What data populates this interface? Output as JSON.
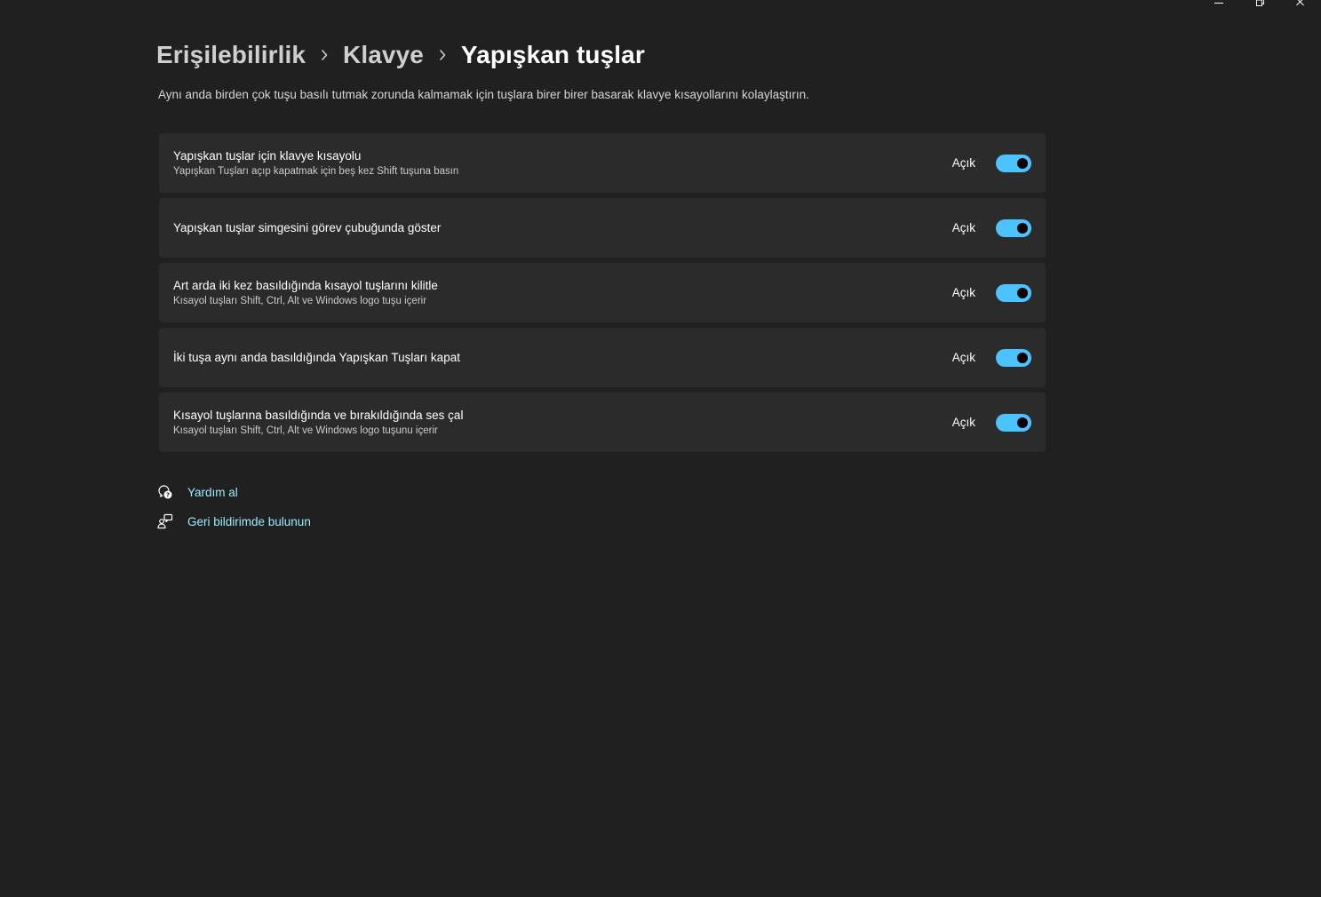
{
  "window": {
    "minimize_icon": "minimize-icon",
    "maximize_icon": "restore-icon",
    "close_icon": "close-icon"
  },
  "breadcrumb": {
    "items": [
      "Erişilebilirlik",
      "Klavye",
      "Yapışkan tuşlar"
    ],
    "separator_icon": "chevron-right-icon"
  },
  "description": "Aynı anda birden çok tuşu basılı tutmak zorunda kalmamak için tuşlara birer birer basarak klavye kısayollarını kolaylaştırın.",
  "settings": [
    {
      "title": "Yapışkan tuşlar için klavye kısayolu",
      "subtitle": "Yapışkan Tuşları açıp kapatmak için beş kez Shift tuşuna basın",
      "state": "Açık"
    },
    {
      "title": "Yapışkan tuşlar simgesini görev çubuğunda göster",
      "subtitle": "",
      "state": "Açık"
    },
    {
      "title": "Art arda iki kez basıldığında kısayol tuşlarını kilitle",
      "subtitle": "Kısayol tuşları Shift, Ctrl, Alt ve Windows logo tuşu içerir",
      "state": "Açık"
    },
    {
      "title": "İki tuşa aynı anda basıldığında Yapışkan Tuşları kapat",
      "subtitle": "",
      "state": "Açık"
    },
    {
      "title": "Kısayol tuşlarına basıldığında ve bırakıldığında ses çal",
      "subtitle": "Kısayol tuşları Shift, Ctrl, Alt ve Windows logo tuşunu içerir",
      "state": "Açık"
    }
  ],
  "links": {
    "help": {
      "label": "Yardım al",
      "icon": "help-chat-icon"
    },
    "feedback": {
      "label": "Geri bildirimde bulunun",
      "icon": "feedback-icon"
    }
  },
  "colors": {
    "background": "#202020",
    "card": "#2b2b2b",
    "accent": "#4cc2ff",
    "link": "#99ebff"
  }
}
